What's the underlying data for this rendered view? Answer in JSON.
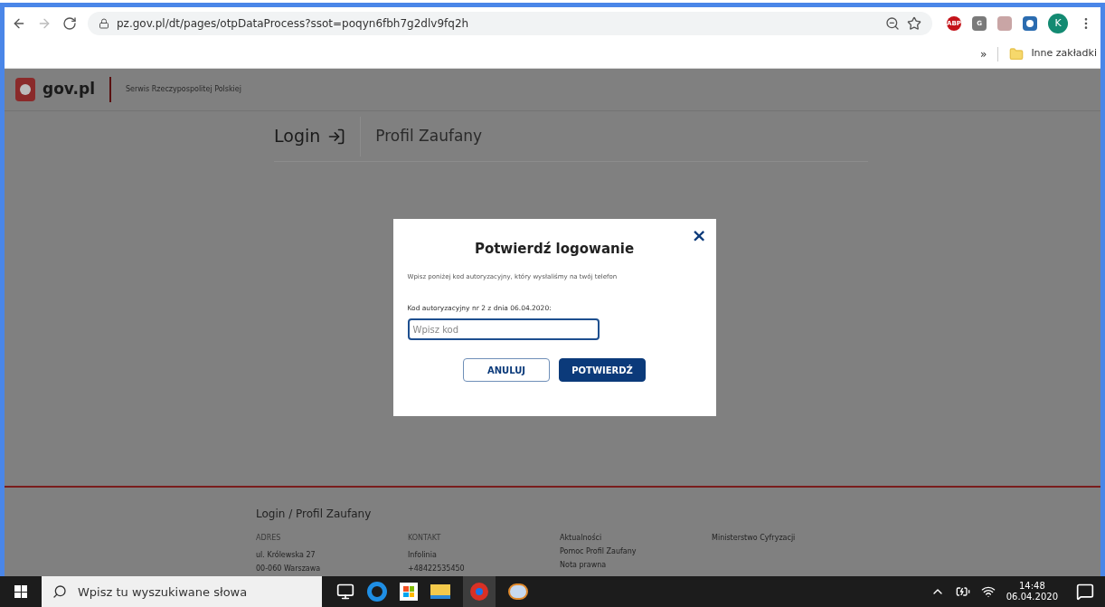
{
  "browser": {
    "url": "pz.gov.pl/dt/pages/otpDataProcess?ssot=poqyn6fbh7g2dlv9fq2h",
    "extensions": [
      {
        "label": "ABP",
        "color": "#c4131a"
      },
      {
        "label": "G",
        "color": "#7a7a7a"
      }
    ],
    "profile": "K",
    "bookmarks_more": "»",
    "bookmark_folder": "Inne zakładki"
  },
  "site_header": {
    "logo": "gov.pl",
    "tagline": "Serwis Rzeczypospolitej Polskiej"
  },
  "page_header": {
    "title": "Login",
    "subtitle": "Profil Zaufany"
  },
  "dialog": {
    "title": "Potwierdź logowanie",
    "close": "×",
    "instruction": "Wpisz poniżej kod autoryzacyjny, który wysłaliśmy na twój telefon",
    "field_label": "Kod autoryzacyjny nr 2 z dnia 06.04.2020:",
    "field": {
      "placeholder": "Wpisz kod"
    },
    "buttons": [
      {
        "label": "ANULUJ",
        "kind": "secondary"
      },
      {
        "label": "POTWIERDŹ",
        "kind": "primary"
      }
    ]
  },
  "footer": {
    "title": "Login / Profil Zaufany",
    "columns": [
      {
        "heading": "ADRES",
        "lines": [
          "ul. Królewska 27",
          "00-060 Warszawa"
        ]
      },
      {
        "heading": "KONTAKT",
        "lines": [
          "Infolinia",
          "+48422535450"
        ]
      },
      {
        "links": [
          "Aktualności",
          "Pomoc Profil Zaufany",
          "Nota prawna"
        ]
      },
      {
        "links": [
          "Ministerstwo Cyfryzacji"
        ]
      }
    ]
  },
  "taskbar": {
    "search": {
      "placeholder": "Wpisz tu wyszukiwane słowa"
    },
    "time": "14:48",
    "date": "06.04.2020"
  }
}
